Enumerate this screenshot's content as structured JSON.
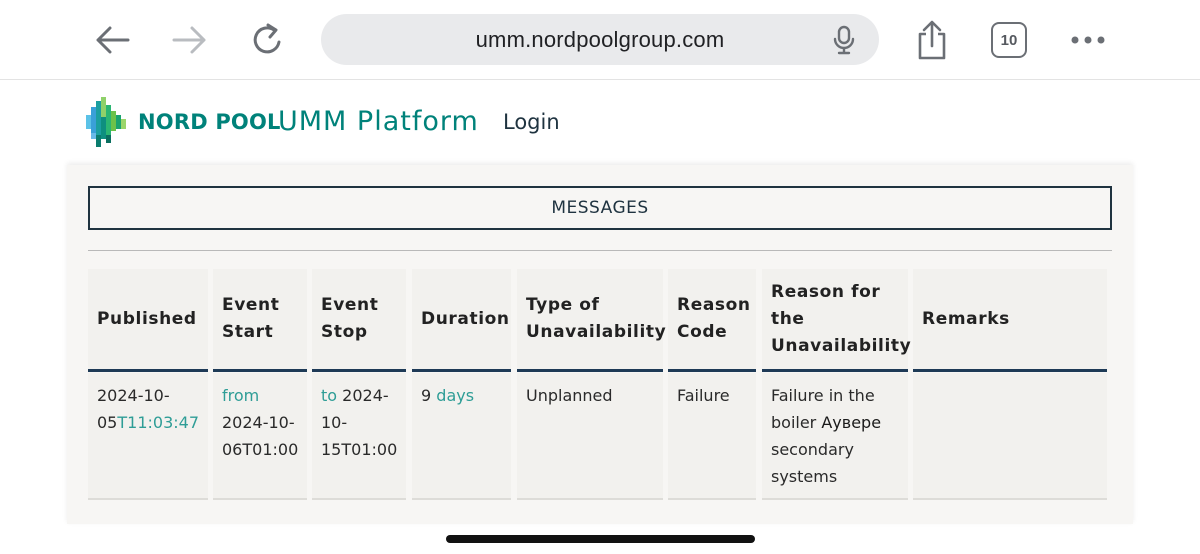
{
  "browser": {
    "url": "umm.nordpoolgroup.com",
    "tab_count": "10",
    "icons": [
      "back-arrow-icon",
      "forward-arrow-icon",
      "reload-icon",
      "microphone-icon",
      "share-icon",
      "tabs-icon",
      "more-icon"
    ]
  },
  "header": {
    "logo_text": "NORD POOL",
    "platform_title": "UMM Platform",
    "login_label": "Login"
  },
  "messages_label": "MESSAGES",
  "table": {
    "headers": {
      "published": "Published",
      "event_start": "Event Start",
      "event_stop": "Event Stop",
      "duration": "Duration",
      "type": "Type of Unavailability",
      "reason_code": "Reason Code",
      "reason": "Reason for the Unavailability",
      "remarks": "Remarks"
    },
    "rows": [
      {
        "published_date": "2024-10-05",
        "published_time": "T11:03:47",
        "start_prefix": "from",
        "start_value": "2024-10-06T01:00",
        "stop_prefix": "to",
        "stop_value": "2024-10-15T01:00",
        "duration_value": "9",
        "duration_unit": "days",
        "type": "Unplanned",
        "reason_code": "Failure",
        "reason_before": "Failure in the boiler",
        "reason_highlight": "Аувере",
        "reason_after": "secondary systems",
        "remarks": ""
      }
    ]
  },
  "colors": {
    "brand_teal": "#00827a",
    "link_teal": "#2e9d96",
    "header_rule": "#1e3a56"
  }
}
